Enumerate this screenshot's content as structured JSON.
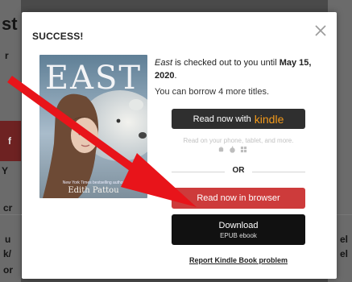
{
  "background": {
    "fragments": [
      "st",
      "r",
      "f",
      "Y",
      "cr",
      "u",
      "k/",
      "or",
      "el",
      "el"
    ]
  },
  "modal": {
    "title": "SUCCESS!",
    "close_label": "×",
    "book": {
      "title": "East",
      "cover_title": "EAST",
      "cover_tagline": "New York Times bestselling author",
      "cover_author": "Edith Pattou"
    },
    "message": {
      "suffix": " is checked out to you until ",
      "due_date": "May 15, 2020",
      "end": "."
    },
    "borrow_text": "You can borrow 4 more titles.",
    "kindle_button": {
      "label": "Read now with",
      "brand": "kindle"
    },
    "devices_text": "Read on your phone, tablet, and more.",
    "device_icons": [
      "android-icon",
      "apple-icon",
      "windows-icon"
    ],
    "or_label": "OR",
    "browser_button": "Read now in browser",
    "download_button": {
      "label": "Download",
      "format": "EPUB ebook"
    },
    "report_link": "Report Kindle Book problem"
  },
  "colors": {
    "kindle_brand": "#f39a1b",
    "browser_button": "#cd3b3b",
    "arrow": "#e8141a"
  }
}
